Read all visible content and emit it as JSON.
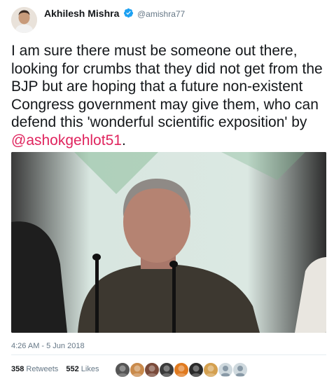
{
  "author": {
    "name": "Akhilesh Mishra",
    "handle": "@amishra77",
    "verified": true,
    "verified_color": "#1da1f2"
  },
  "tweet": {
    "text_before": "I am sure there must be someone out there, looking for crumbs that they did not get from the BJP but are hoping that a future non-existent Congress government may give them, who can defend this 'wonderful scientific exposition' by ",
    "mention": "@ashokgehlot51",
    "text_after": ".",
    "mention_color": "#e0245e"
  },
  "media": {
    "icon": "video-still-image"
  },
  "meta": {
    "timestamp": "4:26 AM - 5 Jun 2018"
  },
  "stats": {
    "retweets_count": "358",
    "retweets_label": "Retweets",
    "likes_count": "552",
    "likes_label": "Likes"
  },
  "likers": [
    {
      "icon": "liker-avatar-icon",
      "color": "#555555"
    },
    {
      "icon": "liker-avatar-icon",
      "color": "#c98a4b"
    },
    {
      "icon": "liker-avatar-icon",
      "color": "#7a4a3a"
    },
    {
      "icon": "liker-avatar-icon",
      "color": "#3b3b3b"
    },
    {
      "icon": "liker-avatar-icon",
      "color": "#e07a1f"
    },
    {
      "icon": "liker-avatar-icon",
      "color": "#2a2a2a"
    },
    {
      "icon": "liker-avatar-icon",
      "color": "#d4a04f"
    },
    {
      "icon": "default-avatar-icon",
      "color": "#cfd9de"
    },
    {
      "icon": "default-avatar-icon",
      "color": "#cfd9de"
    }
  ]
}
